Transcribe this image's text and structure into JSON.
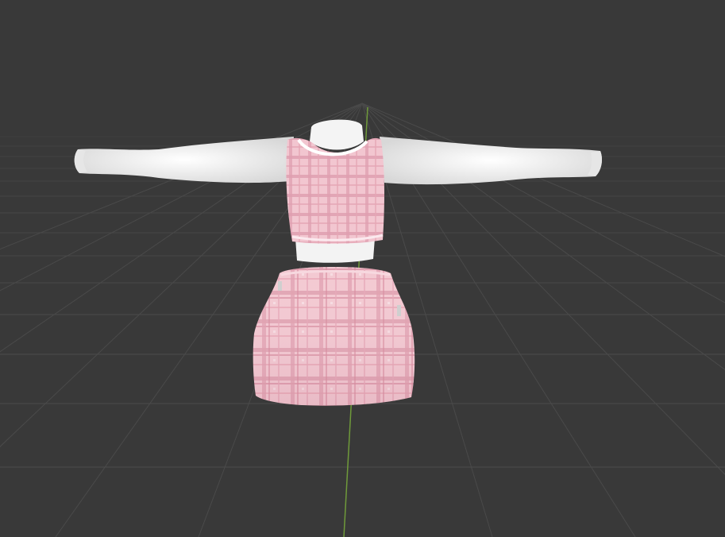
{
  "viewport": {
    "background_color": "#393939",
    "grid_line_color": "#4a4a4a",
    "grid_line_color_major": "#545454",
    "y_axis_color": "#6f9a3a"
  },
  "model": {
    "shirt_color": "#f2f2f2",
    "shirt_shadow_color": "#dcdcdc",
    "plaid_base_color": "#f3c9d2",
    "plaid_stripe_color": "#d98ea0",
    "plaid_fine_color": "#e8a9b8",
    "collar_trim_color": "#ffffff",
    "hem_trim_color": "#fbe9ee"
  }
}
